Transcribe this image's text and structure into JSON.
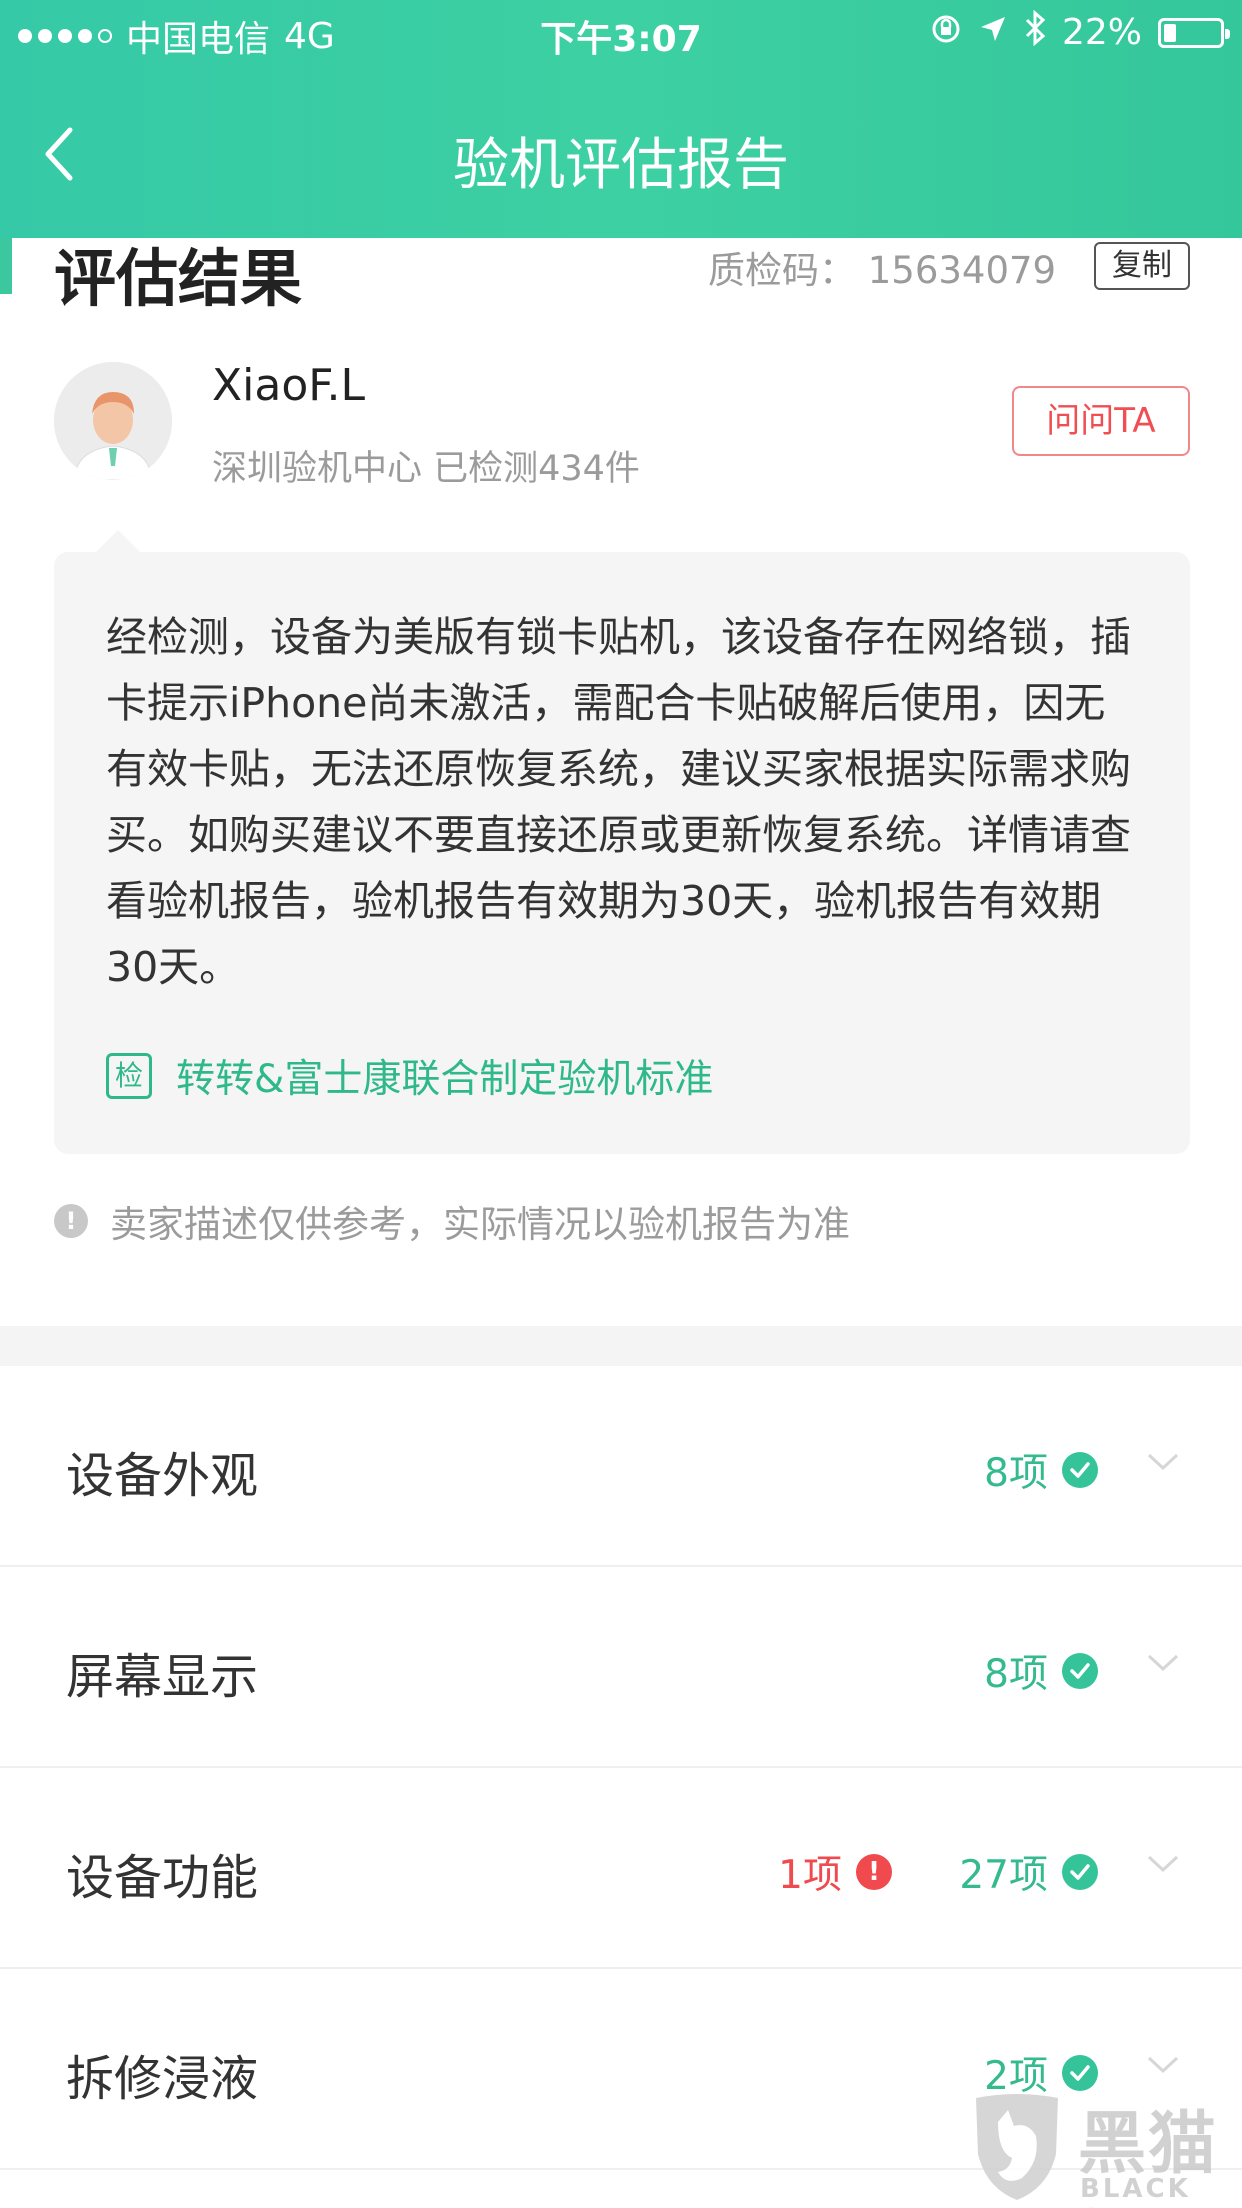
{
  "status_bar": {
    "carrier": "中国电信",
    "network": "4G",
    "time": "下午3:07",
    "battery_percent": "22%",
    "battery_level": 0.22
  },
  "nav": {
    "title": "验机评估报告",
    "back_icon": "chevron-left-icon"
  },
  "result": {
    "title": "评估结果",
    "qc_code_label": "质检码：",
    "qc_code_value": "15634079",
    "copy_label": "复制"
  },
  "inspector": {
    "name": "XiaoF.L",
    "meta": "深圳验机中心 已检测434件",
    "ask_label": "问问TA"
  },
  "note": {
    "text": "经检测，设备为美版有锁卡贴机，该设备存在网络锁，插卡提示iPhone尚未激活，需配合卡贴破解后使用，因无有效卡贴，无法还原恢复系统，建议买家根据实际需求购买。如购买建议不要直接还原或更新恢复系统。详情请查看验机报告，验机报告有效期为30天，验机报告有效期30天。",
    "standard_badge": "检",
    "standard_text": "转转&富士康联合制定验机标准"
  },
  "disclaimer": {
    "icon": "!",
    "text": "卖家描述仅供参考，实际情况以验机报告为准"
  },
  "categories": [
    {
      "name": "设备外观",
      "pass": "8项"
    },
    {
      "name": "屏幕显示",
      "pass": "8项"
    },
    {
      "name": "设备功能",
      "fail": "1项",
      "pass": "27项"
    },
    {
      "name": "拆修浸液",
      "pass": "2项"
    }
  ],
  "watermark": {
    "cn": "黑猫",
    "en": "BLACK CAT"
  },
  "colors": {
    "header_green": "#3dd0a2",
    "pass_green": "#35b98f",
    "fail_red": "#f04a4e"
  }
}
